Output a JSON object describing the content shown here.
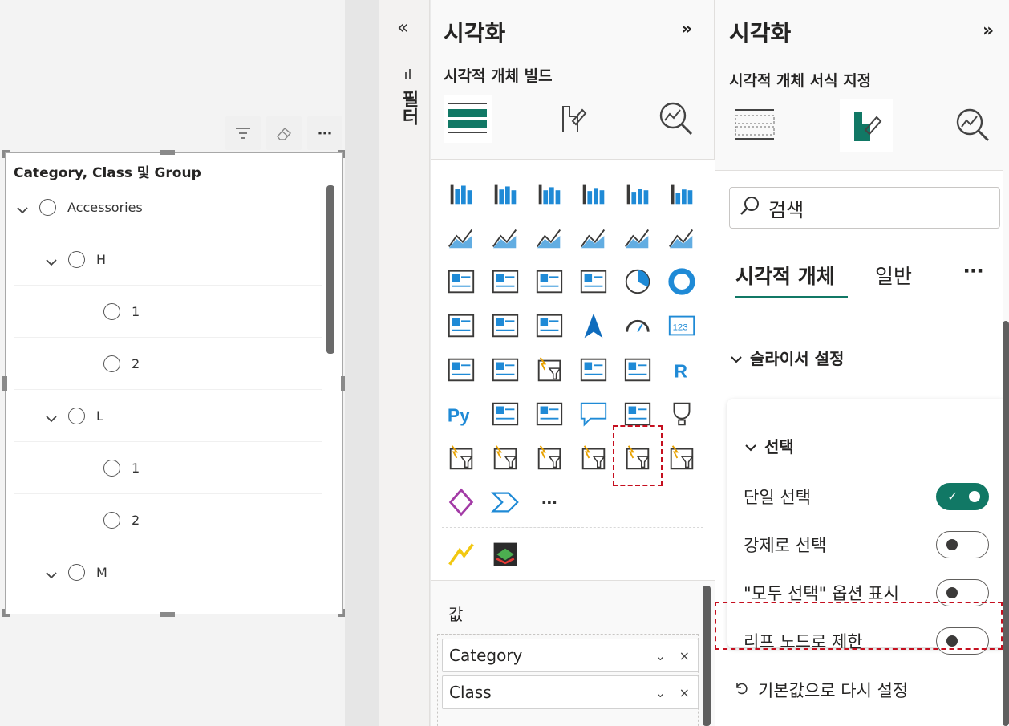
{
  "slicer": {
    "title": "Category, Class 및 Group",
    "rows": [
      {
        "label": "Accessories",
        "level": 0,
        "expandable": true
      },
      {
        "label": "H",
        "level": 1,
        "expandable": true
      },
      {
        "label": "1",
        "level": 2,
        "expandable": false
      },
      {
        "label": "2",
        "level": 2,
        "expandable": false
      },
      {
        "label": "L",
        "level": 1,
        "expandable": true
      },
      {
        "label": "1",
        "level": 2,
        "expandable": false
      },
      {
        "label": "2",
        "level": 2,
        "expandable": false
      },
      {
        "label": "M",
        "level": 1,
        "expandable": true
      }
    ],
    "toolbar": [
      "filter-icon",
      "eraser-icon",
      "more-options-icon"
    ],
    "more_label": "⋯"
  },
  "filter_pane": {
    "collapse_glyph": "«",
    "label": "필터"
  },
  "viz_pane": {
    "title": "시각화",
    "expand_glyph": "»",
    "subtitle": "시각적 개체 빌드",
    "tabs": [
      "build-visual-icon",
      "format-visual-icon",
      "analytics-icon"
    ],
    "visual_icons": [
      "stacked-bar-icon",
      "stacked-column-icon",
      "clustered-bar-icon",
      "clustered-column-icon",
      "100-stacked-bar-icon",
      "100-stacked-column-icon",
      "line-chart-icon",
      "area-chart-icon",
      "stacked-area-icon",
      "100-stacked-area-icon",
      "line-stacked-column-icon",
      "line-clustered-column-icon",
      "ribbon-chart-icon",
      "waterfall-icon",
      "funnel-icon",
      "scatter-icon",
      "pie-chart-icon",
      "donut-chart-icon",
      "treemap-icon",
      "map-icon",
      "filled-map-icon",
      "azure-map-icon",
      "gauge-icon",
      "card-icon",
      "multi-row-card-icon",
      "kpi-icon",
      "slicer-icon",
      "table-icon",
      "matrix-icon",
      "r-visual-icon",
      "python-visual-icon",
      "key-influencers-icon",
      "decomposition-tree-icon",
      "qa-icon",
      "smart-narrative-icon",
      "goals-icon",
      "paginated-report-icon",
      "new-card-icon",
      "new-slicer-icon",
      "button-slicer-icon",
      "list-slicer-icon",
      "arcgis-map-icon",
      "power-apps-icon",
      "power-automate-icon",
      "more-visuals-icon"
    ],
    "more_visuals_glyph": "⋯",
    "custom_icons": [
      "custom-visual-1-icon",
      "custom-visual-2-icon"
    ],
    "values_label": "값",
    "fields": [
      "Category",
      "Class"
    ],
    "remove_glyph": "×"
  },
  "format_pane": {
    "title": "시각화",
    "expand_glyph": "»",
    "subtitle": "시각적 개체 서식 지정",
    "search_placeholder": "검색",
    "tabs": [
      "시각적 개체",
      "일반"
    ],
    "tabs_more_glyph": "⋯",
    "section_title": "슬라이서 설정",
    "card_title": "선택",
    "options": [
      {
        "label": "단일 선택",
        "on": true
      },
      {
        "label": "강제로 선택",
        "on": false
      },
      {
        "label": "\"모두 선택\" 옵션 표시",
        "on": false
      },
      {
        "label": "리프 노드로 제한",
        "on": false
      }
    ],
    "reset_label": "기본값으로 다시 설정",
    "accent_color": "#117865",
    "highlight_color": "#c50f1f"
  }
}
